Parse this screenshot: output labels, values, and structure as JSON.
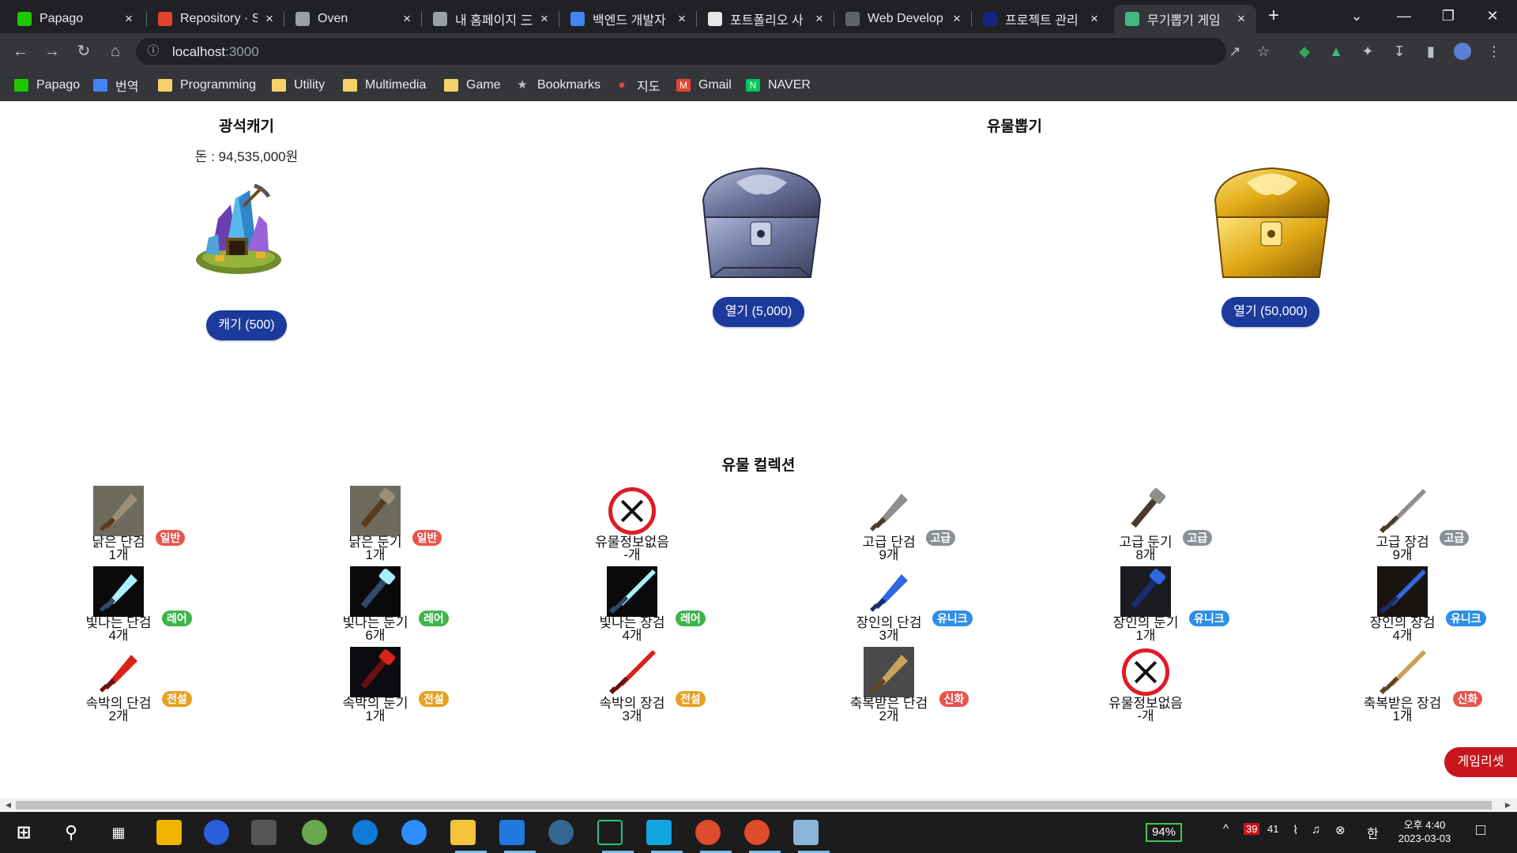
{
  "browser": {
    "tabs": [
      {
        "title": "Papago",
        "fav": "#1ec800"
      },
      {
        "title": "Repository · S",
        "fav": "#e2432a"
      },
      {
        "title": "Oven",
        "fav": "#9aa0a6"
      },
      {
        "title": "내 홈페이지 三",
        "fav": "#9aa0a6"
      },
      {
        "title": "백엔드 개발자",
        "fav": "#4285f4"
      },
      {
        "title": "포트폴리오 사",
        "fav": "#e8e8e8"
      },
      {
        "title": "Web Develop",
        "fav": "#5f6368"
      },
      {
        "title": "프로젝트 관리",
        "fav": "#1a237e"
      },
      {
        "title": "무기뽑기 게임",
        "fav": "#41b883"
      }
    ],
    "new_tab": "+",
    "address": {
      "host": "localhost",
      "port": ":3000"
    },
    "bookmarks": [
      {
        "label": "Papago",
        "icon": "papago-icon"
      },
      {
        "label": "번역",
        "icon": "translate-icon"
      },
      {
        "label": "Programming",
        "icon": "folder-icon"
      },
      {
        "label": "Utility",
        "icon": "folder-icon"
      },
      {
        "label": "Multimedia",
        "icon": "folder-icon"
      },
      {
        "label": "Game",
        "icon": "folder-icon"
      },
      {
        "label": "Bookmarks",
        "icon": "star-icon"
      },
      {
        "label": "지도",
        "icon": "map-pin-icon"
      },
      {
        "label": "Gmail",
        "icon": "gmail-icon"
      },
      {
        "label": "NAVER",
        "icon": "naver-icon"
      }
    ]
  },
  "mining": {
    "title": "광석캐기",
    "money": "돈 : 94,535,000원",
    "button": "캐기 (500)"
  },
  "gacha": {
    "title": "유물뽑기",
    "silver_button": "열기 (5,000)",
    "gold_button": "열기 (50,000)"
  },
  "collection": {
    "title": "유물 컬렉션",
    "rows": [
      [
        {
          "name": "낡은 단검",
          "count": "1개",
          "grade": "일반",
          "color": "#e8554e",
          "art": "rusty-dagger"
        },
        {
          "name": "낡은 둔기",
          "count": "1개",
          "grade": "일반",
          "color": "#e8554e",
          "art": "rusty-mace"
        },
        {
          "name": "유물정보없음",
          "count": "-개",
          "grade": "",
          "color": "",
          "art": "none"
        },
        {
          "name": "고급 단검",
          "count": "9개",
          "grade": "고급",
          "color": "#8a8f98",
          "art": "fine-dagger"
        },
        {
          "name": "고급 둔기",
          "count": "8개",
          "grade": "고급",
          "color": "#8a8f98",
          "art": "fine-mace"
        },
        {
          "name": "고급 장검",
          "count": "9개",
          "grade": "고급",
          "color": "#8a8f98",
          "art": "fine-sword"
        }
      ],
      [
        {
          "name": "빛나는 단검",
          "count": "4개",
          "grade": "레어",
          "color": "#3cb54a",
          "art": "shining-dagger"
        },
        {
          "name": "빛나는 둔기",
          "count": "6개",
          "grade": "레어",
          "color": "#3cb54a",
          "art": "shining-mace"
        },
        {
          "name": "빛나는 장검",
          "count": "4개",
          "grade": "레어",
          "color": "#3cb54a",
          "art": "shining-sword"
        },
        {
          "name": "장인의 단검",
          "count": "3개",
          "grade": "유니크",
          "color": "#2e8ee8",
          "art": "master-dagger"
        },
        {
          "name": "장인의 둔기",
          "count": "1개",
          "grade": "유니크",
          "color": "#2e8ee8",
          "art": "master-mace"
        },
        {
          "name": "장인의 장검",
          "count": "4개",
          "grade": "유니크",
          "color": "#2e8ee8",
          "art": "master-sword"
        }
      ],
      [
        {
          "name": "속박의 단검",
          "count": "2개",
          "grade": "전설",
          "color": "#e8a022",
          "art": "bound-dagger"
        },
        {
          "name": "속박의 둔기",
          "count": "1개",
          "grade": "전설",
          "color": "#e8a022",
          "art": "bound-mace"
        },
        {
          "name": "속박의 장검",
          "count": "3개",
          "grade": "전설",
          "color": "#e8a022",
          "art": "bound-sword"
        },
        {
          "name": "축복받은 단검",
          "count": "2개",
          "grade": "신화",
          "color": "#e8554e",
          "art": "blessed-dagger"
        },
        {
          "name": "유물정보없음",
          "count": "-개",
          "grade": "",
          "color": "",
          "art": "none"
        },
        {
          "name": "축복받은 장검",
          "count": "1개",
          "grade": "신화",
          "color": "#e8554e",
          "art": "blessed-sword"
        }
      ]
    ]
  },
  "reset_button": "게임리셋",
  "taskbar": {
    "battery": "94%",
    "notif_red": "39",
    "notif_purple": "41",
    "ime": "한",
    "time": "오후 4:40",
    "date": "2023-03-03"
  }
}
